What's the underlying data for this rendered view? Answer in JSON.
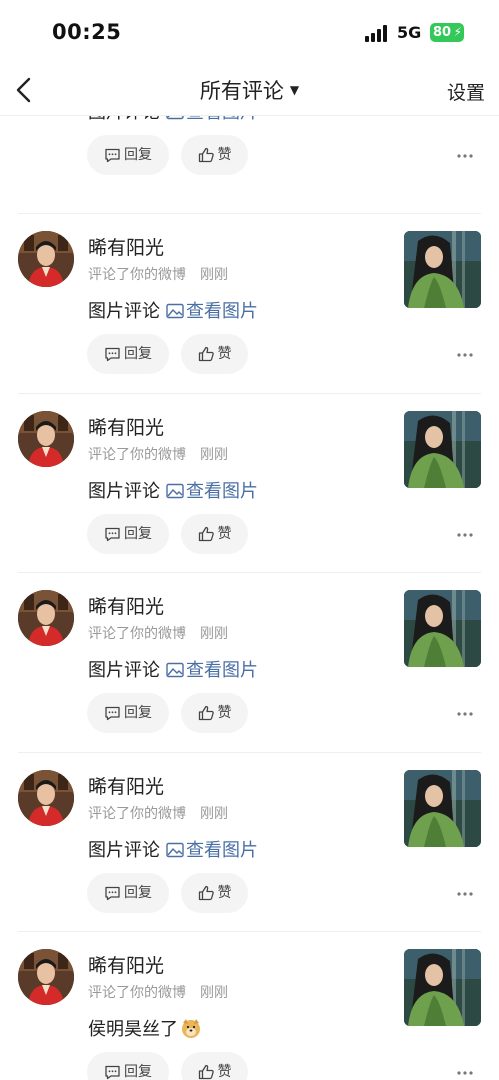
{
  "status_bar": {
    "time": "00:25",
    "network": "5G",
    "battery": "80"
  },
  "nav": {
    "title": "所有评论",
    "settings": "设置"
  },
  "items": [
    {
      "name": "",
      "subline": "",
      "when": "",
      "content": "图片评论",
      "link": "查看图片"
    },
    {
      "name": "晞有阳光",
      "subline": "评论了你的微博",
      "when": "刚刚",
      "content": "图片评论",
      "link": "查看图片"
    },
    {
      "name": "晞有阳光",
      "subline": "评论了你的微博",
      "when": "刚刚",
      "content": "图片评论",
      "link": "查看图片"
    },
    {
      "name": "晞有阳光",
      "subline": "评论了你的微博",
      "when": "刚刚",
      "content": "图片评论",
      "link": "查看图片"
    },
    {
      "name": "晞有阳光",
      "subline": "评论了你的微博",
      "when": "刚刚",
      "content": "图片评论",
      "link": "查看图片"
    },
    {
      "name": "晞有阳光",
      "subline": "评论了你的微博",
      "when": "刚刚",
      "content": "侯明昊丝了",
      "link": ""
    }
  ],
  "actions": {
    "reply": "回复",
    "like": "赞"
  },
  "icons": {
    "back": "back-chevron-icon",
    "caret": "caret-down-icon",
    "picture": "picture-icon",
    "comment": "comment-icon",
    "like": "thumbs-up-icon",
    "more": "more-dots-icon",
    "emoji": "doge-emoji-icon"
  },
  "colors": {
    "link": "#4a6fa5",
    "battery": "#34c759",
    "pill_bg": "#f4f4f4",
    "meta_text": "#999999"
  }
}
